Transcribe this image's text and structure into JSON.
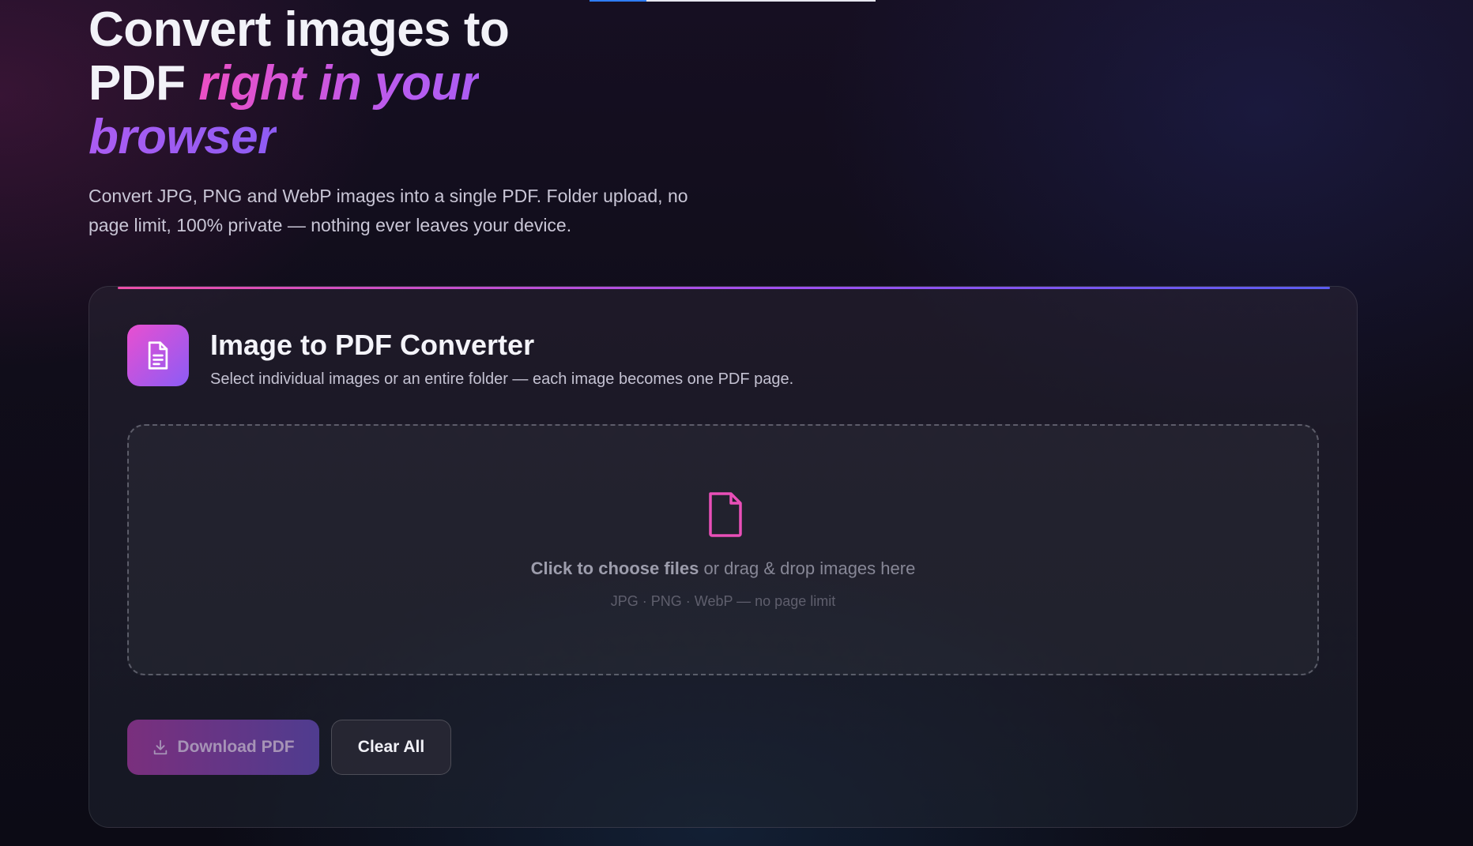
{
  "hero": {
    "title_part1": "Convert images to PDF ",
    "title_accent": "right in your browser",
    "description": "Convert JPG, PNG and WebP images into a single PDF. Folder upload, no page limit, 100% private — nothing ever leaves your device."
  },
  "converter": {
    "icon": "document-icon",
    "title": "Image to PDF Converter",
    "subtitle": "Select individual images or an entire folder — each image becomes one PDF page.",
    "dropzone": {
      "icon": "file-icon",
      "action_label": "Click to choose files",
      "action_rest": " or drag & drop images here",
      "formats_note": "JPG · PNG · WebP — no page limit"
    },
    "buttons": {
      "download_label": "Download PDF",
      "download_icon": "download-icon",
      "clear_label": "Clear All"
    }
  },
  "colors": {
    "accent_pink": "#ec4fc4",
    "accent_purple": "#8e5cf3",
    "dropzone_icon": "#e94fb8",
    "top_progress_fill": "#2f7dfa"
  }
}
